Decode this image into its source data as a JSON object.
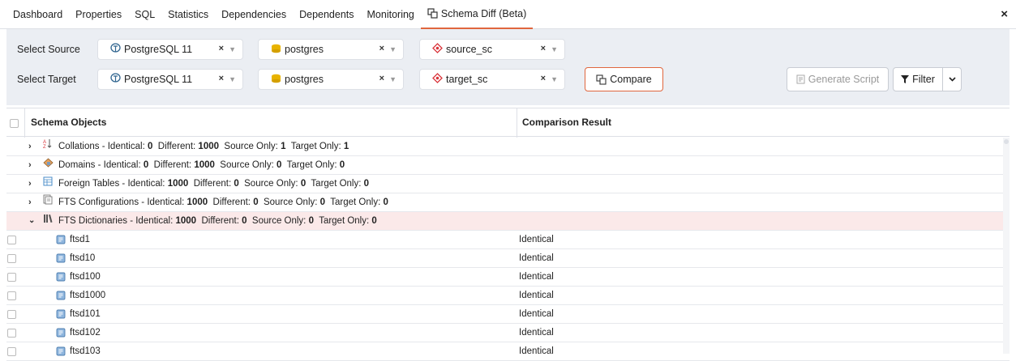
{
  "tabs": [
    "Dashboard",
    "Properties",
    "SQL",
    "Statistics",
    "Dependencies",
    "Dependents",
    "Monitoring"
  ],
  "active_tab": "Schema Diff (Beta)",
  "close": "×",
  "source": {
    "label": "Select Source",
    "server": "PostgreSQL 11",
    "database": "postgres",
    "schema": "source_sc"
  },
  "target": {
    "label": "Select Target",
    "server": "PostgreSQL 11",
    "database": "postgres",
    "schema": "target_sc"
  },
  "clear_glyph": "×",
  "compare_label": "Compare",
  "generate_script_label": "Generate Script",
  "filter_label": "Filter",
  "columns": {
    "objects": "Schema Objects",
    "result": "Comparison Result"
  },
  "groups": [
    {
      "name": "Collations",
      "icon": "collation-icon",
      "identical": "0",
      "different": "1000",
      "source_only": "1",
      "target_only": "1",
      "expanded": false
    },
    {
      "name": "Domains",
      "icon": "domain-icon",
      "identical": "0",
      "different": "1000",
      "source_only": "0",
      "target_only": "0",
      "expanded": false
    },
    {
      "name": "Foreign Tables",
      "icon": "foreign-table-icon",
      "identical": "1000",
      "different": "0",
      "source_only": "0",
      "target_only": "0",
      "expanded": false
    },
    {
      "name": "FTS Configurations",
      "icon": "fts-configuration-icon",
      "identical": "1000",
      "different": "0",
      "source_only": "0",
      "target_only": "0",
      "expanded": false
    },
    {
      "name": "FTS Dictionaries",
      "icon": "fts-dictionary-icon",
      "identical": "1000",
      "different": "0",
      "source_only": "0",
      "target_only": "0",
      "expanded": true
    }
  ],
  "stat_labels": {
    "identical": "Identical:",
    "different": "Different:",
    "source_only": "Source Only:",
    "target_only": "Target Only:"
  },
  "items": [
    {
      "name": "ftsd1",
      "result": "Identical"
    },
    {
      "name": "ftsd10",
      "result": "Identical"
    },
    {
      "name": "ftsd100",
      "result": "Identical"
    },
    {
      "name": "ftsd1000",
      "result": "Identical"
    },
    {
      "name": "ftsd101",
      "result": "Identical"
    },
    {
      "name": "ftsd102",
      "result": "Identical"
    },
    {
      "name": "ftsd103",
      "result": "Identical"
    }
  ],
  "colors": {
    "accent": "#e0663e",
    "toolbar_bg": "#ebeef3",
    "expanded_row_bg": "#fbe9e9"
  }
}
